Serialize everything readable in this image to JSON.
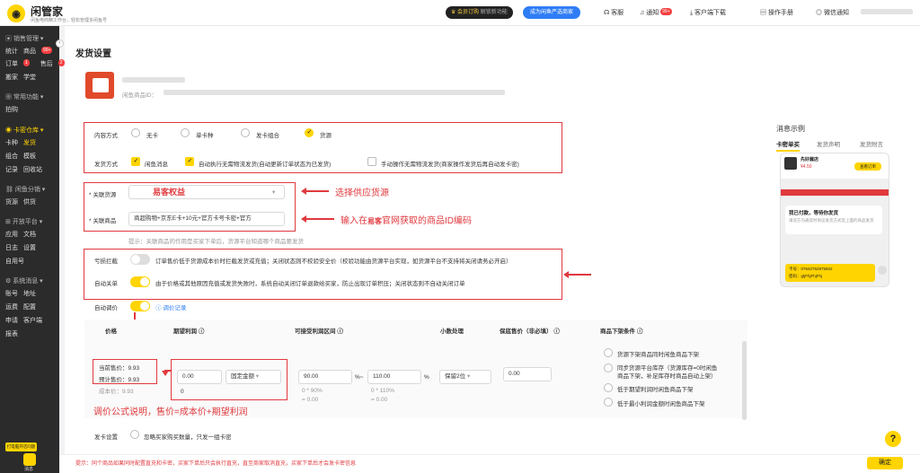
{
  "topbar": {
    "app_name": "闲管家",
    "app_sub": "闲鱼电商精工作台，轻松管理多闲鱼号",
    "vip": "会员订购",
    "vip_sub": "解锁新功能",
    "merchant": "成为闲鱼严选商家",
    "service": "客服",
    "notify": "通知",
    "notify_badge": "99+",
    "download": "客户端下载",
    "manual": "操作手册",
    "wechat": "微信通知"
  },
  "sidebar": {
    "groups": {
      "sales": "销售管理",
      "common": "常用功能",
      "card": "卡密仓库",
      "dist": "闲鱼分销",
      "open": "开放平台",
      "system": "系统消息"
    },
    "items": {
      "stats": "统计",
      "goods": "商品",
      "goods_badge": "99+",
      "orders": "订单",
      "orders_badge": "1",
      "aftersale": "售后",
      "aftersale_badge": "2",
      "move": "搬家",
      "learn": "学堂",
      "poll": "拍购",
      "cardkind": "卡种",
      "ship": "发货",
      "combo": "组合",
      "template": "模板",
      "record": "记录",
      "recycle": "回收站",
      "goods2": "货源",
      "supply": "供货",
      "apps": "应用",
      "doc": "文档",
      "log": "日志",
      "settings": "设置",
      "selfuse": "自用号",
      "account": "账号",
      "address": "地址",
      "freight": "运费",
      "config": "配置",
      "apply": "申请",
      "client": "客户端",
      "report": "报表"
    },
    "promo_btn": "打电脑开店问题",
    "bottom_label": "消息"
  },
  "page": {
    "title": "发货设置",
    "product_label": "闲鱼商品ID："
  },
  "content": {
    "label": "内容方式",
    "options": [
      "无卡",
      "单卡种",
      "发卡组合",
      "货源"
    ],
    "selected": 3
  },
  "ship": {
    "label": "发货方式",
    "options": [
      "闲鱼消息",
      "自动执行无需物流发货(自动更新订单状态为已发货)",
      "手动操作无需物流发货(商家操作发货后再自动发卡密)"
    ],
    "checked": [
      true,
      true,
      false
    ]
  },
  "source": {
    "label": "* 关联货源",
    "value": "易客权益",
    "product_label": "* 关联商品",
    "product_value": "商超购物+京东E卡+10元+官方卡号卡密+官方",
    "hint": "提示：关联商品的作用是买家下单后，货源平台知道哪个商品要发货"
  },
  "switches": {
    "loss": {
      "label": "亏损拦截",
      "on": false,
      "desc": "订单售价低于货源成本价时拦截发货或充值；关闭状态则不校验安全价（校验功能由货源平台实现，如货源平台不支持将关闭请务必开启）"
    },
    "autoclose": {
      "label": "自动关单",
      "on": true,
      "desc": "由于价格或其他原因充值或发货失败时，系统自动关闭订单退款给买家，防止出现订单积压；关闭状态则不自动关闭订单"
    },
    "autoprice": {
      "label": "自动调价",
      "on": true,
      "link": "调价记录"
    }
  },
  "pricing": {
    "headers": {
      "price": "价格",
      "profit": "期望利润",
      "range": "可接受利润区间",
      "decimal": "小数处理",
      "minprice": "保底售价（非必填）",
      "conditions": "商品下架条件"
    },
    "current_price": "当前售价：9.93",
    "expected_price": "预计售价：9.93",
    "cost_price": "成本价：9.93",
    "profit_value": "0.00",
    "profit_type": "固定金额",
    "profit_below": "0",
    "range_low": "90.00",
    "range_low_sub": "0 * 90%",
    "range_low_eq": "= 0.00",
    "range_high": "110.00",
    "range_high_sub": "0 * 110%",
    "range_high_eq": "= 0.00",
    "pct": "%",
    "tilde": "%~",
    "decimal_value": "保留2位",
    "min_value": "0.00",
    "conditions": [
      "货源下架商品同时闲鱼商品下架",
      "同步货源平台库存（货源库存=0时闲鱼商品下架，补足库存时商品自动上架）",
      "低于期望利润时闲鱼商品下架",
      "低于最小利润金额时闲鱼商品下架"
    ]
  },
  "card_setting": {
    "label": "发卡设置",
    "desc": "忽略买家购买数量，只发一组卡密"
  },
  "annotations": {
    "supply": "选择供应货源",
    "product_pre": "输入在",
    "product_brand": "易客",
    "product_post": "官网获取的商品ID编码",
    "formula": "调价公式说明，售价=成本价+期望利润"
  },
  "preview": {
    "title": "消息示例",
    "tabs": [
      "卡密单买",
      "发货声明",
      "发货附言"
    ],
    "shop": "先好酱店",
    "price": "¥4.50",
    "order": "查看订单",
    "msg_title": "我已付款，等待你发货",
    "msg_sub": "请双方沟通及时商议发货方式及上面的商品发货",
    "card_no": "卡号：07642762975922",
    "card_pw": "密码：gtjFhjFhjFhj"
  },
  "bottom": {
    "tip": "提示：同个商品如果同时配置直充和卡密，买家下单后只会执行直充，直至商家取消直充，买家下单后才会发卡密信息",
    "ok": "确定",
    "help": "?"
  }
}
